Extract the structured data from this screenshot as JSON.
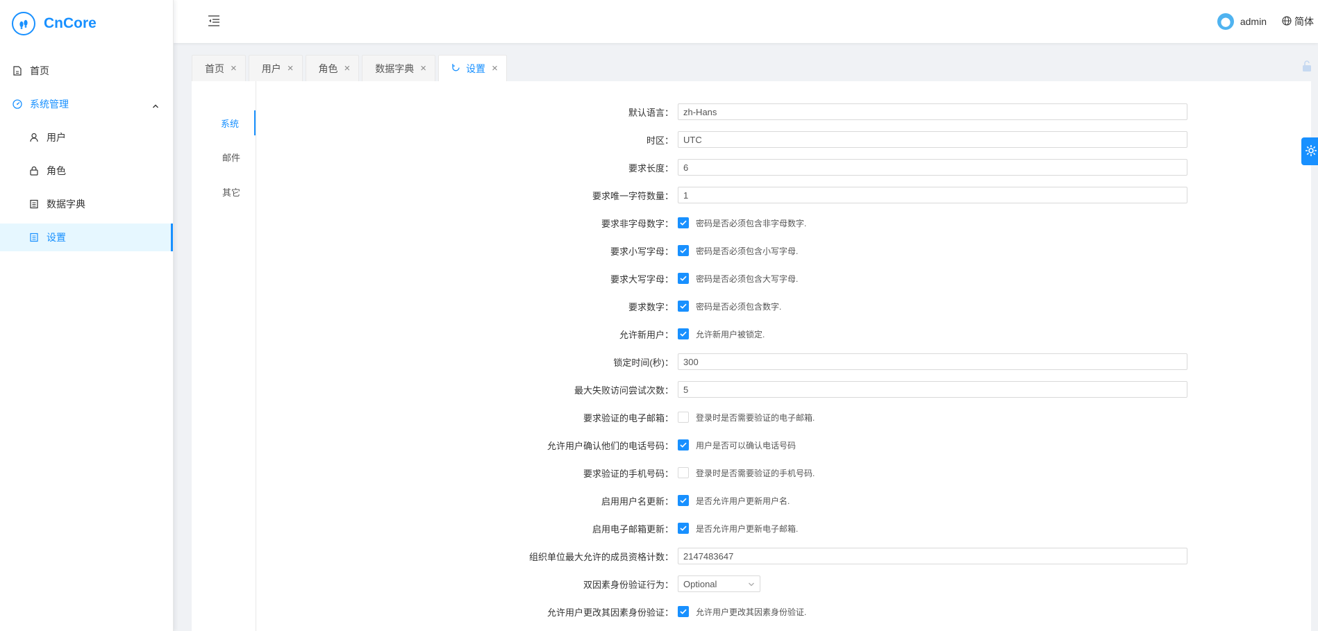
{
  "app": {
    "name": "CnCore"
  },
  "header": {
    "user": "admin",
    "language": "简体"
  },
  "sidebar": {
    "items": [
      {
        "label": "首页",
        "icon": "file-icon"
      },
      {
        "label": "系统管理",
        "icon": "dashboard-icon"
      },
      {
        "label": "用户",
        "icon": "user-icon"
      },
      {
        "label": "角色",
        "icon": "lock-icon"
      },
      {
        "label": "数据字典",
        "icon": "profile-icon"
      },
      {
        "label": "设置",
        "icon": "profile-icon"
      }
    ]
  },
  "tabs": [
    {
      "label": "首页"
    },
    {
      "label": "用户"
    },
    {
      "label": "角色"
    },
    {
      "label": "数据字典"
    },
    {
      "label": "设置"
    }
  ],
  "settings": {
    "vtabs": [
      "系统",
      "邮件",
      "其它"
    ],
    "rows": [
      {
        "label": "默认语言：",
        "value": "zh-Hans"
      },
      {
        "label": "时区：",
        "value": "UTC"
      },
      {
        "label": "要求长度：",
        "value": "6"
      },
      {
        "label": "要求唯一字符数量：",
        "value": "1"
      },
      {
        "label": "要求非字母数字：",
        "text": "密码是否必须包含非字母数字."
      },
      {
        "label": "要求小写字母：",
        "text": "密码是否必须包含小写字母."
      },
      {
        "label": "要求大写字母：",
        "text": "密码是否必须包含大写字母."
      },
      {
        "label": "要求数字：",
        "text": "密码是否必须包含数字."
      },
      {
        "label": "允许新用户：",
        "text": "允许新用户被锁定."
      },
      {
        "label": "锁定时间(秒)：",
        "value": "300"
      },
      {
        "label": "最大失败访问尝试次数：",
        "value": "5"
      },
      {
        "label": "要求验证的电子邮箱：",
        "text": "登录时是否需要验证的电子邮箱."
      },
      {
        "label": "允许用户确认他们的电话号码：",
        "text": "用户是否可以确认电话号码"
      },
      {
        "label": "要求验证的手机号码：",
        "text": "登录时是否需要验证的手机号码."
      },
      {
        "label": "启用用户名更新：",
        "text": "是否允许用户更新用户名."
      },
      {
        "label": "启用电子邮箱更新：",
        "text": "是否允许用户更新电子邮箱."
      },
      {
        "label": "组织单位最大允许的成员资格计数：",
        "value": "2147483647"
      },
      {
        "label": "双因素身份验证行为：",
        "value": "Optional"
      },
      {
        "label": "允许用户更改其因素身份验证：",
        "text": "允许用户更改其因素身份验证."
      }
    ]
  },
  "checks": {
    "r4": true,
    "r5": true,
    "r6": true,
    "r7": true,
    "r8": true,
    "r11": false,
    "r12": true,
    "r13": false,
    "r14": true,
    "r15": true,
    "r18": true
  },
  "colors": {
    "primary": "#1890ff",
    "active_bg": "#e6f7ff"
  }
}
